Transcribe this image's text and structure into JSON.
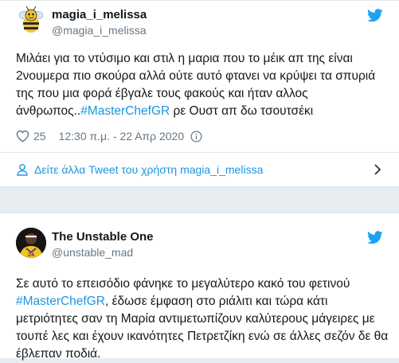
{
  "tweets": [
    {
      "name": "magia_i_melissa",
      "handle": "@magia_i_melissa",
      "text_before": "Μιλάει για το ντύσιμο και στιλ η μαρια που το μέικ απ της είναι 2νουμερα πιο σκούρα αλλά ούτε αυτό φτανει να κρύψει τα σπυριά της που μια φορά έβγαλε τους φακούς και ήταν αλλος άνθρωπος..",
      "hashtag": "#MasterChefGR",
      "text_after": " ρε Ουστ απ δω τσουτσέκι",
      "likes": "25",
      "timestamp": "12:30 π.μ. - 22 Απρ 2020",
      "more_label": "Δείτε άλλα Tweet του χρήστη magia_i_melissa"
    },
    {
      "name": "The Unstable One",
      "handle": "@unstable_mad",
      "text_before": "Σε αυτό το επεισόδιο φάνηκε το μεγαλύτερο κακό του φετινού ",
      "hashtag": "#MasterChefGR",
      "text_after": ", έδωσε έμφαση στο ριάλιτι και τώρα κάτι μετριότητες σαν τη Μαρία αντιμετωπίζουν καλύτερους μάγειρες με τουπέ λες και έχουν ικανότητες Πετρετζίκη ενώ σε άλλες σεζόν δε θα έβλεπαν ποδιά."
    }
  ],
  "colors": {
    "twitter_blue": "#1da1f2",
    "link_blue": "#1b95e0",
    "secondary_text": "#657786",
    "background": "#e6ecf0"
  },
  "icons": {
    "brand": "twitter-bird-icon",
    "like": "heart-icon",
    "info": "info-icon",
    "profile": "user-icon",
    "chevron": "chevron-right-icon"
  }
}
